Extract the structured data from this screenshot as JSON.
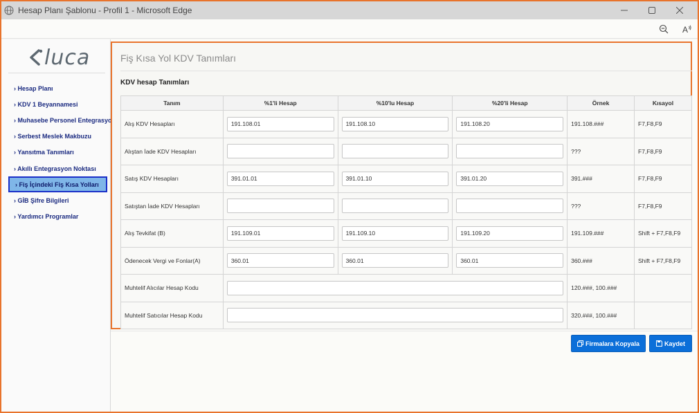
{
  "window": {
    "title": "Hesap Planı Şablonu - Profil 1 - Microsoft Edge",
    "controls": [
      "minimize-icon",
      "maximize-icon",
      "close-icon"
    ]
  },
  "toolbar": {
    "icons": [
      "zoom-out-icon",
      "read-aloud-icon"
    ]
  },
  "logo": {
    "text": "luca",
    "color": "#5c6770"
  },
  "sidebar": {
    "items": [
      {
        "label": "› Hesap Planı",
        "active": false
      },
      {
        "label": "› KDV 1 Beyannamesi",
        "active": false
      },
      {
        "label": "› Muhasebe Personel Entegrasyon",
        "active": false
      },
      {
        "label": "› Serbest Meslek Makbuzu",
        "active": false
      },
      {
        "label": "› Yansıtma Tanımları",
        "active": false
      },
      {
        "label": "› Akıllı Entegrasyon Noktası",
        "active": false
      },
      {
        "label": "› Fiş İçindeki Fiş Kısa Yolları",
        "active": true
      },
      {
        "label": "› GİB Şifre Bilgileri",
        "active": false
      },
      {
        "label": "› Yardımcı Programlar",
        "active": false
      }
    ]
  },
  "main": {
    "page_title": "Fiş Kısa Yol KDV Tanımları",
    "section_title": "KDV hesap Tanımları",
    "columns": [
      "Tanım",
      "%1'li Hesap",
      "%10'lu Hesap",
      "%20'li Hesap",
      "Örnek",
      "Kısayol"
    ],
    "rows": [
      {
        "label": "Alış KDV Hesapları",
        "v1": "191.108.01",
        "v10": "191.108.10",
        "v20": "191.108.20",
        "example": "191.108.###",
        "shortcut": "F7,F8,F9"
      },
      {
        "label": "Alıştan İade KDV Hesapları",
        "v1": "",
        "v10": "",
        "v20": "",
        "example": "???",
        "shortcut": "F7,F8,F9"
      },
      {
        "label": "Satış KDV Hesapları",
        "v1": "391.01.01",
        "v10": "391.01.10",
        "v20": "391.01.20",
        "example": "391.###",
        "shortcut": "F7,F8,F9"
      },
      {
        "label": "Satıştan İade KDV Hesapları",
        "v1": "",
        "v10": "",
        "v20": "",
        "example": "???",
        "shortcut": "F7,F8,F9"
      },
      {
        "label": "Alış Tevkifat (B)",
        "v1": "191.109.01",
        "v10": "191.109.10",
        "v20": "191.109.20",
        "example": "191.109.###",
        "shortcut": "Shift + F7,F8,F9"
      },
      {
        "label": "Ödenecek Vergi ve Fonlar(A)",
        "v1": "360.01",
        "v10": "360.01",
        "v20": "360.01",
        "example": "360.###",
        "shortcut": "Shift + F7,F8,F9"
      }
    ],
    "wide_rows": [
      {
        "label": "Muhtelif Alıcılar Hesap Kodu",
        "value": "",
        "example": "120.###, 100.###",
        "shortcut": ""
      },
      {
        "label": "Muhtelif Satıcılar Hesap Kodu",
        "value": "",
        "example": "320.###, 100.###",
        "shortcut": ""
      }
    ]
  },
  "actions": {
    "copy_label": "Firmalara Kopyala",
    "save_label": "Kaydet",
    "accent": "#0b6fd9"
  },
  "colors": {
    "highlight": "#e8732b",
    "active_border": "#1a2fc8",
    "active_bg": "#7fb6e8",
    "menu_text": "#1a2a80"
  }
}
